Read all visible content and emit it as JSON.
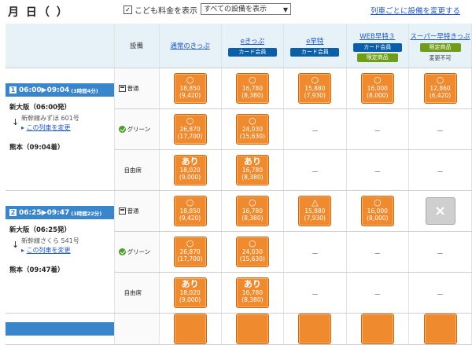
{
  "header": {
    "date_title": "月 日（ ）",
    "kids_check_mark": "✓",
    "kids_label": "こども料金を表示",
    "facility_select": "すべての設備を表示",
    "change_per_train_link": "列車ごとに設備を変更する"
  },
  "columns": {
    "seat_header": "設備",
    "items": [
      {
        "title": "通常のきっぷ",
        "badges": [],
        "note": ""
      },
      {
        "title": "eきっぷ",
        "badges": [
          {
            "text": "カード会員",
            "color": "#0b5ea8"
          }
        ],
        "note": ""
      },
      {
        "title": "e早特",
        "badges": [
          {
            "text": "カード会員",
            "color": "#0b5ea8"
          }
        ],
        "note": ""
      },
      {
        "title": "WEB早特３",
        "badges": [
          {
            "text": "カード会員",
            "color": "#0b5ea8"
          },
          {
            "text": "限定商品",
            "color": "#6f9d1b"
          }
        ],
        "note": ""
      },
      {
        "title": "スーパー早特きっぷ",
        "badges": [
          {
            "text": "限定商品",
            "color": "#6f9d1b"
          }
        ],
        "note": "変更不可"
      }
    ]
  },
  "seat_types": {
    "normal": "普通",
    "green": "グリーン",
    "free": "自由席"
  },
  "dash": "－",
  "change_train_link": "この列車を変更",
  "trains": [
    {
      "index": "1",
      "time": "06:00▶09:04",
      "duration": "(3時間4分)",
      "from": "新大阪（06:00発）",
      "train_name": "新幹線みずほ 601号",
      "to": "熊本（09:04着）",
      "rows": {
        "normal": [
          {
            "symbol": "○",
            "price": "18,850",
            "child": "(9,420)"
          },
          {
            "symbol": "○",
            "price": "16,780",
            "child": "(8,380)"
          },
          {
            "symbol": "○",
            "price": "15,880",
            "child": "(7,930)"
          },
          {
            "symbol": "○",
            "price": "16,000",
            "child": "(8,000)"
          },
          {
            "symbol": "○",
            "price": "12,860",
            "child": "(6,420)"
          }
        ],
        "green": [
          {
            "symbol": "○",
            "price": "26,870",
            "child": "(17,700)"
          },
          {
            "symbol": "○",
            "price": "24,030",
            "child": "(15,630)"
          }
        ],
        "free": [
          {
            "symbol": "あり",
            "price": "18,020",
            "child": "(9,000)"
          },
          {
            "symbol": "あり",
            "price": "16,780",
            "child": "(8,380)"
          }
        ]
      }
    },
    {
      "index": "2",
      "time": "06:25▶09:47",
      "duration": "(3時間22分)",
      "from": "新大阪（06:25発）",
      "train_name": "新幹線さくら 541号",
      "to": "熊本（09:47着）",
      "rows": {
        "normal": [
          {
            "symbol": "○",
            "price": "18,850",
            "child": "(9,420)"
          },
          {
            "symbol": "○",
            "price": "16,780",
            "child": "(8,380)"
          },
          {
            "symbol": "△",
            "price": "15,880",
            "child": "(7,930)"
          },
          {
            "symbol": "○",
            "price": "16,000",
            "child": "(8,000)"
          },
          {
            "symbol": "×",
            "price": "",
            "child": ""
          }
        ],
        "green": [
          {
            "symbol": "○",
            "price": "26,870",
            "child": "(17,700)"
          },
          {
            "symbol": "○",
            "price": "24,030",
            "child": "(15,630)"
          }
        ],
        "free": [
          {
            "symbol": "あり",
            "price": "18,020",
            "child": "(9,000)"
          },
          {
            "symbol": "あり",
            "price": "16,780",
            "child": "(8,380)"
          }
        ]
      }
    }
  ]
}
